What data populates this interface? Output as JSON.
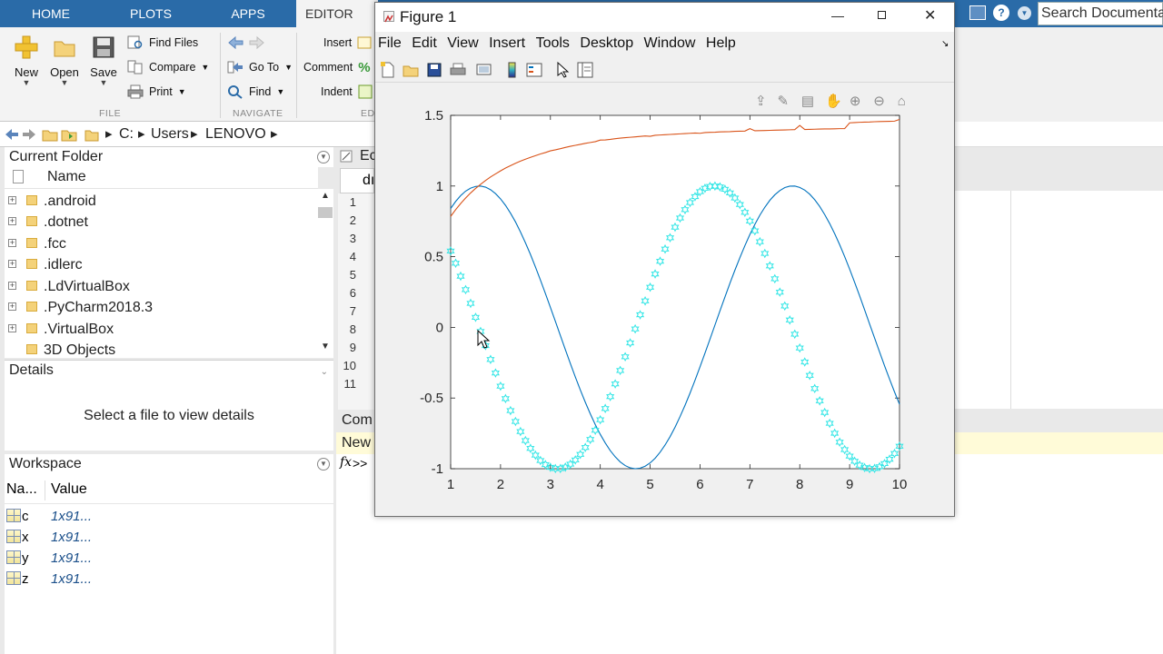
{
  "ribbon": {
    "tabs": [
      {
        "label": "HOME"
      },
      {
        "label": "PLOTS"
      },
      {
        "label": "APPS"
      },
      {
        "label": "EDITOR"
      }
    ],
    "file_group": {
      "label": "FILE",
      "new": "New",
      "open": "Open",
      "save": "Save",
      "find_files": "Find Files",
      "compare": "Compare",
      "print": "Print"
    },
    "navigate_group": {
      "label": "NAVIGATE",
      "go_to": "Go To",
      "find": "Find"
    },
    "edit_group": {
      "label": "ED",
      "insert": "Insert",
      "comment": "Comment",
      "indent": "Indent"
    },
    "search_placeholder": "Search Documentation"
  },
  "address": {
    "path": [
      "C:",
      "Users",
      "LENOVO"
    ]
  },
  "current_folder": {
    "title": "Current Folder",
    "column_name": "Name",
    "items": [
      {
        "name": ".android",
        "expandable": true
      },
      {
        "name": ".dotnet",
        "expandable": true
      },
      {
        "name": ".fcc",
        "expandable": true
      },
      {
        "name": ".idlerc",
        "expandable": true
      },
      {
        "name": ".LdVirtualBox",
        "expandable": true
      },
      {
        "name": ".PyCharm2018.3",
        "expandable": true
      },
      {
        "name": ".VirtualBox",
        "expandable": true
      },
      {
        "name": "3D Objects",
        "expandable": false
      }
    ]
  },
  "details": {
    "title": "Details",
    "message": "Select a file to view details"
  },
  "workspace": {
    "title": "Workspace",
    "col_name": "Na...",
    "col_value": "Value",
    "vars": [
      {
        "name": "c",
        "value": "1x91..."
      },
      {
        "name": "x",
        "value": "1x91..."
      },
      {
        "name": "y",
        "value": "1x91..."
      },
      {
        "name": "z",
        "value": "1x91..."
      }
    ]
  },
  "editor": {
    "title": "Ec",
    "tab": "dı",
    "line_numbers": [
      "1",
      "2",
      "3",
      "4",
      "5",
      "6",
      "7",
      "8",
      "9",
      "10",
      "11"
    ]
  },
  "command_window": {
    "title": "Com",
    "new_bar": "New",
    "fx": "fx",
    "prompt": ">>"
  },
  "figure": {
    "title": "Figure 1",
    "menu": [
      "File",
      "Edit",
      "View",
      "Insert",
      "Tools",
      "Desktop",
      "Window",
      "Help"
    ]
  },
  "chart_data": {
    "type": "line",
    "title": "",
    "xlabel": "",
    "ylabel": "",
    "xlim": [
      1,
      10
    ],
    "ylim": [
      -1,
      1.5
    ],
    "xticks": [
      "1",
      "2",
      "3",
      "4",
      "5",
      "6",
      "7",
      "8",
      "9",
      "10"
    ],
    "yticks": [
      "-1",
      "-0.5",
      "0",
      "0.5",
      "1",
      "1.5"
    ],
    "x_start": 1,
    "x_step": 0.1,
    "n_points": 91,
    "series": [
      {
        "color": "#0072BD",
        "marker": "none",
        "expression": "sin(x)",
        "values": [
          0.841,
          0.891,
          0.932,
          0.964,
          0.985,
          0.997,
          1.0,
          0.992,
          0.974,
          0.946,
          0.909,
          0.863,
          0.808,
          0.746,
          0.675,
          0.598,
          0.516,
          0.427,
          0.335,
          0.239,
          0.141,
          0.042,
          -0.058,
          -0.158,
          -0.256,
          -0.351,
          -0.443,
          -0.53,
          -0.612,
          -0.688,
          -0.757,
          -0.818,
          -0.872,
          -0.916,
          -0.952,
          -0.978,
          -0.994,
          -1.0,
          -0.996,
          -0.982,
          -0.959,
          -0.926,
          -0.883,
          -0.832,
          -0.773,
          -0.706,
          -0.631,
          -0.551,
          -0.465,
          -0.374,
          -0.279,
          -0.182,
          -0.083,
          0.017,
          0.117,
          0.215,
          0.312,
          0.405,
          0.494,
          0.578,
          0.657,
          0.729,
          0.794,
          0.85,
          0.899,
          0.938,
          0.968,
          0.989,
          0.999,
          1.0,
          0.99,
          0.971,
          0.942,
          0.903,
          0.855,
          0.798,
          0.734,
          0.663,
          0.585,
          0.501,
          0.412,
          0.319,
          0.223,
          0.124,
          0.024,
          -0.075,
          -0.174,
          -0.272,
          -0.366,
          -0.457,
          -0.544
        ]
      },
      {
        "color": "#D95319",
        "marker": "none",
        "expression": "atan(x)",
        "values": [
          0.785,
          0.833,
          0.876,
          0.915,
          0.951,
          0.983,
          1.012,
          1.039,
          1.064,
          1.086,
          1.107,
          1.127,
          1.144,
          1.161,
          1.176,
          1.19,
          1.203,
          1.215,
          1.227,
          1.237,
          1.249,
          1.256,
          1.264,
          1.273,
          1.281,
          1.288,
          1.295,
          1.302,
          1.308,
          1.314,
          1.325,
          1.326,
          1.33,
          1.335,
          1.339,
          1.342,
          1.345,
          1.348,
          1.351,
          1.354,
          1.352,
          1.359,
          1.361,
          1.363,
          1.365,
          1.367,
          1.369,
          1.371,
          1.373,
          1.375,
          1.373,
          1.378,
          1.38,
          1.381,
          1.383,
          1.384,
          1.385,
          1.387,
          1.388,
          1.389,
          1.406,
          1.391,
          1.392,
          1.393,
          1.394,
          1.395,
          1.396,
          1.397,
          1.398,
          1.399,
          1.429,
          1.4,
          1.401,
          1.402,
          1.403,
          1.404,
          1.404,
          1.405,
          1.406,
          1.406,
          1.447,
          1.449,
          1.451,
          1.452,
          1.453,
          1.455,
          1.456,
          1.457,
          1.458,
          1.459,
          1.471
        ]
      },
      {
        "color": "#33E6E6",
        "marker": "hexagram",
        "expression": "cos(x-1)",
        "values": [
          0.54,
          0.454,
          0.362,
          0.267,
          0.17,
          0.071,
          -0.029,
          -0.129,
          -0.227,
          -0.323,
          -0.416,
          -0.504,
          -0.589,
          -0.666,
          -0.737,
          -0.801,
          -0.856,
          -0.904,
          -0.942,
          -0.971,
          -0.99,
          -0.999,
          -0.999,
          -0.989,
          -0.968,
          -0.938,
          -0.899,
          -0.85,
          -0.793,
          -0.728,
          -0.654,
          -0.574,
          -0.49,
          -0.4,
          -0.305,
          -0.208,
          -0.11,
          -0.011,
          0.089,
          0.187,
          0.284,
          0.378,
          0.468,
          0.554,
          0.634,
          0.709,
          0.774,
          0.833,
          0.883,
          0.925,
          0.96,
          0.984,
          0.997,
          1.0,
          0.994,
          0.977,
          0.951,
          0.915,
          0.869,
          0.814,
          0.752,
          0.683,
          0.606,
          0.523,
          0.435,
          0.344,
          0.249,
          0.151,
          0.052,
          -0.048,
          -0.146,
          -0.245,
          -0.34,
          -0.433,
          -0.52,
          -0.602,
          -0.679,
          -0.749,
          -0.812,
          -0.865,
          -0.911,
          -0.947,
          -0.975,
          -0.992,
          -1.0,
          -0.998,
          -0.986,
          -0.964,
          -0.933,
          -0.892,
          -0.841
        ]
      }
    ]
  },
  "colors": {
    "ribbon_blue": "#2a6ba8",
    "plot_blue": "#0072BD",
    "plot_orange": "#D95319",
    "plot_cyan": "#33E6E6",
    "command_bar_yellow": "#fffbd8"
  }
}
